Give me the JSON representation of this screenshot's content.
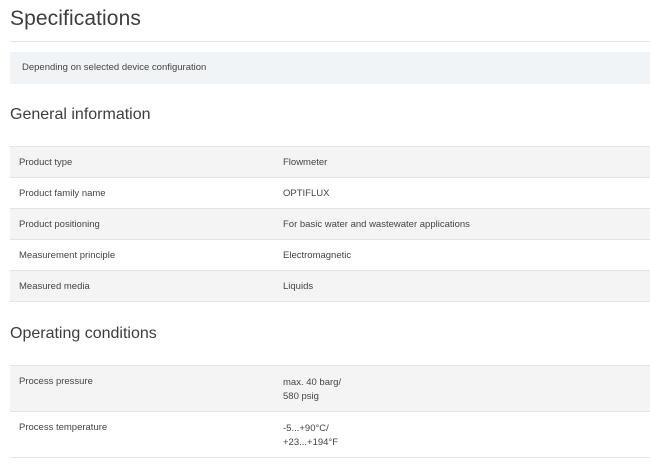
{
  "page": {
    "title": "Specifications",
    "config_note": "Depending on selected device configuration"
  },
  "sections": {
    "general": {
      "title": "General information",
      "rows": [
        {
          "label": "Product type",
          "value": "Flowmeter"
        },
        {
          "label": "Product family name",
          "value": "OPTIFLUX"
        },
        {
          "label": "Product positioning",
          "value": "For basic water and wastewater applications"
        },
        {
          "label": "Measurement principle",
          "value": "Electromagnetic"
        },
        {
          "label": "Measured media",
          "value": "Liquids"
        }
      ]
    },
    "operating": {
      "title": "Operating conditions",
      "rows": [
        {
          "label": "Process pressure",
          "value_lines": [
            "max. 40 barg/",
            "580 psig"
          ]
        },
        {
          "label": "Process temperature",
          "value_lines": [
            "-5...+90°C/",
            "+23...+194°F"
          ]
        }
      ]
    }
  }
}
